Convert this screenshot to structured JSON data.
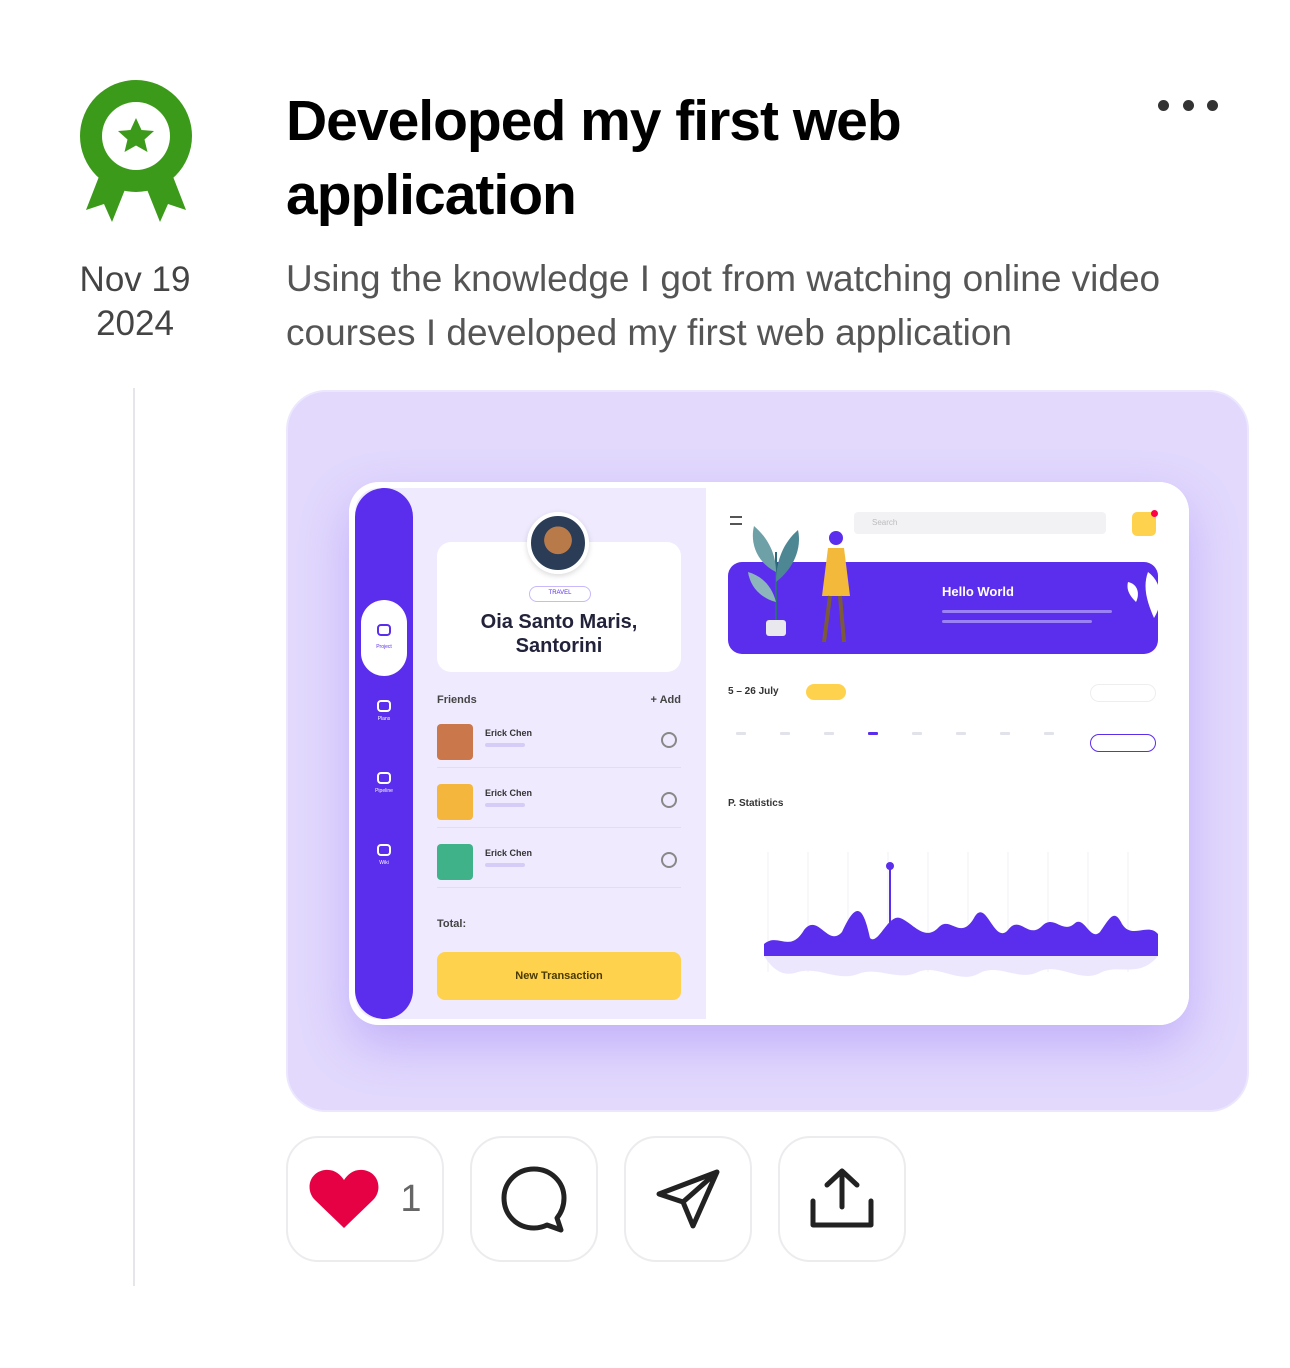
{
  "post": {
    "date_month_day": "Nov 19",
    "date_year": "2024",
    "title": "Developed my first web application",
    "description": "Using the knowledge I got from watching online video courses I developed my first web application",
    "badge_color": "#3c9a1a"
  },
  "media": {
    "background_color": "#e2d9fd",
    "dashboard": {
      "profile_tag": "TRAVEL",
      "place_name": "Oia Santo Maris, Santorini",
      "friends_label": "Friends",
      "add_label": "+ Add",
      "friends": [
        {
          "name": "Erick Chen"
        },
        {
          "name": "Erick Chen"
        },
        {
          "name": "Erick Chen"
        }
      ],
      "total_label": "Total:",
      "new_transaction_label": "New Transaction",
      "search_placeholder": "Search",
      "hero_title": "Hello World",
      "date_range": "5 – 26 July",
      "stats_title": "P. Statistics",
      "rail_items": [
        "Project",
        "Plans",
        "Pipeline",
        "Wiki"
      ],
      "accent_color": "#5b2ded",
      "yellow_color": "#ffd24d"
    }
  },
  "actions": {
    "like_count": "1",
    "like_color": "#e60044",
    "icons": [
      "heart-icon",
      "comment-icon",
      "send-icon",
      "share-icon"
    ]
  }
}
